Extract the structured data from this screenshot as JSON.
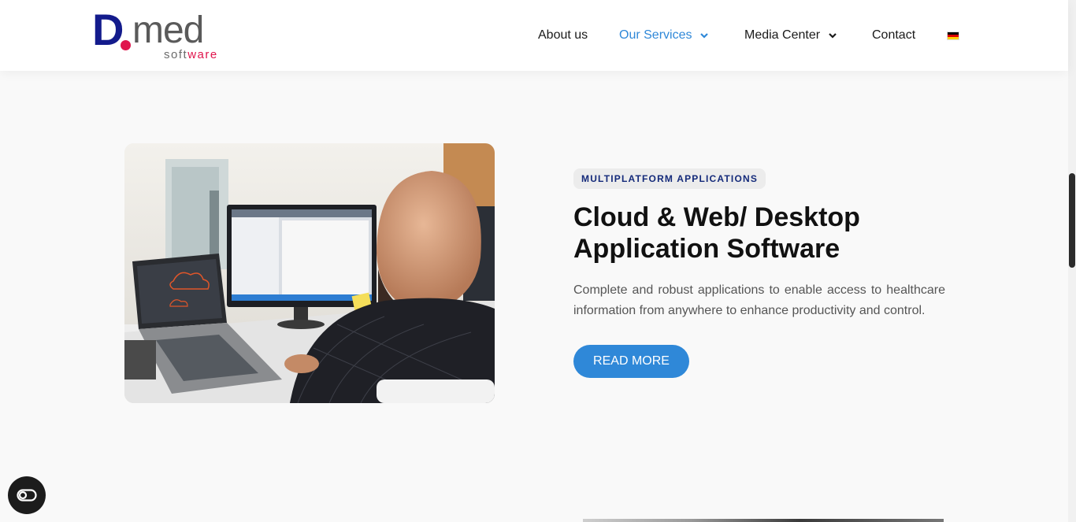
{
  "header": {
    "logo": {
      "main": "D",
      "suffix": "med",
      "sub_a": "soft",
      "sub_b": "ware"
    },
    "nav": [
      {
        "label": "About us",
        "active": false,
        "dropdown": false
      },
      {
        "label": "Our Services",
        "active": true,
        "dropdown": true
      },
      {
        "label": "Media Center",
        "active": false,
        "dropdown": true
      },
      {
        "label": "Contact",
        "active": false,
        "dropdown": false
      }
    ],
    "language_icon": "german-flag-icon"
  },
  "section": {
    "badge": "MULTIPLATFORM APPLICATIONS",
    "title": "Cloud & Web/ Desktop Application Software",
    "description": "Complete and robust applications to enable access to healthcare information from anywhere to enhance productivity and control.",
    "button": "READ MORE"
  },
  "colors": {
    "accent": "#2f88d8",
    "brand_blue": "#131b8c",
    "brand_red": "#e0144c",
    "badge_text": "#142a7a"
  },
  "accessibility_icon": "accessibility-toggle-icon"
}
